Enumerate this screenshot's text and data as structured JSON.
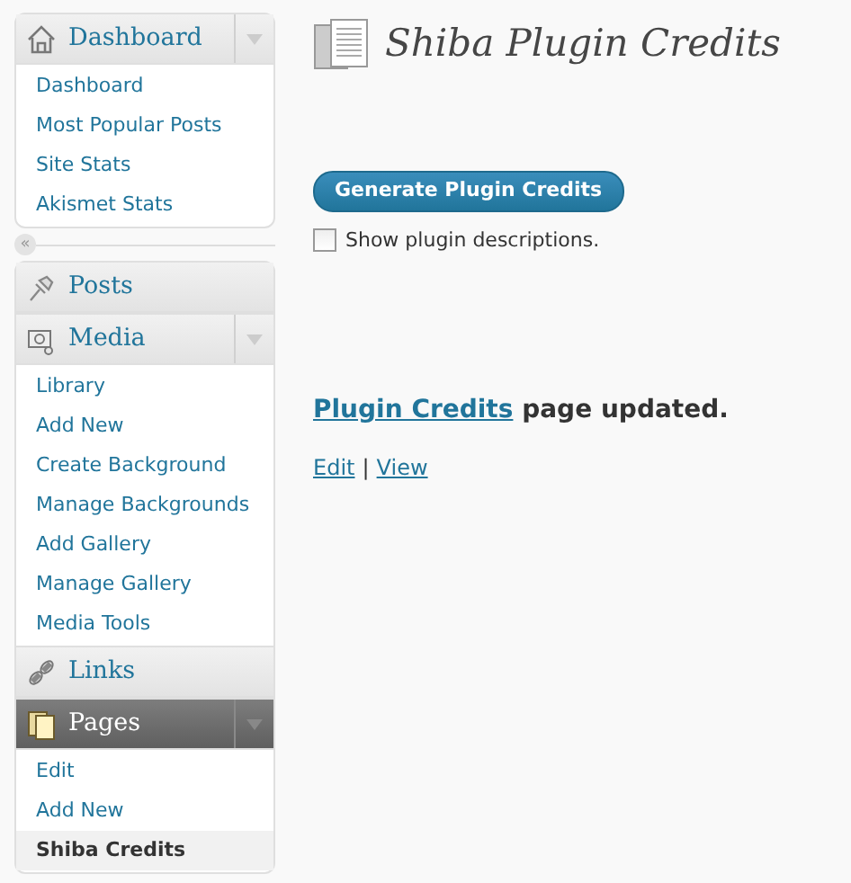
{
  "sidebar": {
    "sections": [
      {
        "label": "Dashboard",
        "current": false,
        "expanded": true,
        "items": [
          {
            "label": "Dashboard",
            "selected": false
          },
          {
            "label": "Most Popular Posts",
            "selected": false
          },
          {
            "label": "Site Stats",
            "selected": false
          },
          {
            "label": "Akismet Stats",
            "selected": false
          }
        ]
      },
      {
        "kind": "collapse",
        "label": "«"
      },
      {
        "label": "Posts",
        "current": false
      },
      {
        "label": "Media",
        "current": false,
        "expanded": true,
        "items": [
          {
            "label": "Library",
            "selected": false
          },
          {
            "label": "Add New",
            "selected": false
          },
          {
            "label": "Create Background",
            "selected": false
          },
          {
            "label": "Manage Backgrounds",
            "selected": false
          },
          {
            "label": "Add Gallery",
            "selected": false
          },
          {
            "label": "Manage Gallery",
            "selected": false
          },
          {
            "label": "Media Tools",
            "selected": false
          }
        ]
      },
      {
        "label": "Links",
        "current": false
      },
      {
        "label": "Pages",
        "current": true,
        "expanded": true,
        "items": [
          {
            "label": "Edit",
            "selected": false
          },
          {
            "label": "Add New",
            "selected": false
          },
          {
            "label": "Shiba Credits",
            "selected": true
          }
        ]
      }
    ]
  },
  "page": {
    "title": "Shiba Plugin Credits",
    "button": "Generate Plugin Credits",
    "checkbox": {
      "label": "Show plugin descriptions.",
      "checked": false
    },
    "message": {
      "link": "Plugin Credits",
      "text": "page updated."
    },
    "actions": [
      {
        "kind": "link",
        "label": "Edit"
      },
      {
        "kind": "separator",
        "label": "|"
      },
      {
        "kind": "link",
        "label": "View"
      }
    ]
  }
}
